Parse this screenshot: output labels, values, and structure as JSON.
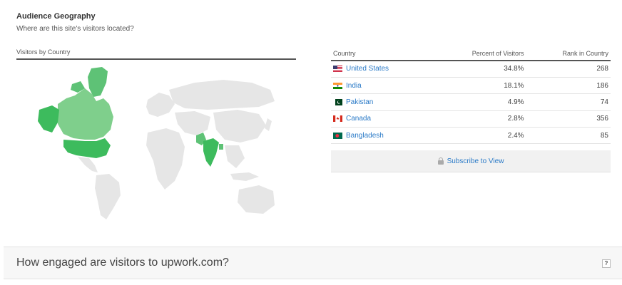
{
  "section": {
    "title": "Audience Geography",
    "subtitle": "Where are this site's visitors located?"
  },
  "map": {
    "header": "Visitors by Country",
    "highlighted": [
      "United States",
      "India",
      "Pakistan",
      "Canada",
      "Bangladesh"
    ],
    "colors": {
      "base": "#e6e6e6",
      "strong": "#3dbb5d",
      "light": "#7fcf8c",
      "mid": "#5ec276"
    }
  },
  "table": {
    "headers": {
      "country": "Country",
      "percent": "Percent of Visitors",
      "rank": "Rank in Country"
    },
    "rows": [
      {
        "country": "United States",
        "flag": "us-flag",
        "percent": "34.8%",
        "rank": "268"
      },
      {
        "country": "India",
        "flag": "india-flag",
        "percent": "18.1%",
        "rank": "186"
      },
      {
        "country": "Pakistan",
        "flag": "pakistan-flag",
        "percent": "4.9%",
        "rank": "74"
      },
      {
        "country": "Canada",
        "flag": "canada-flag",
        "percent": "2.8%",
        "rank": "356"
      },
      {
        "country": "Bangladesh",
        "flag": "bangladesh-flag",
        "percent": "2.4%",
        "rank": "85"
      }
    ],
    "subscribe_label": "Subscribe to View"
  },
  "engaged": {
    "title": "How engaged are visitors to upwork.com?",
    "help_label": "?"
  }
}
